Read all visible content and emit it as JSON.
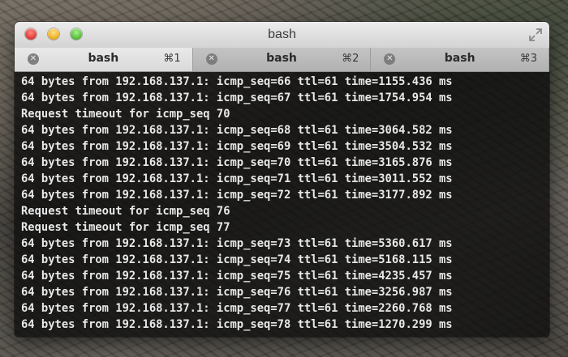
{
  "window": {
    "title": "bash"
  },
  "tabs": [
    {
      "label": "bash",
      "shortcut": "⌘1",
      "active": true
    },
    {
      "label": "bash",
      "shortcut": "⌘2",
      "active": false
    },
    {
      "label": "bash",
      "shortcut": "⌘3",
      "active": false
    }
  ],
  "terminal": {
    "lines": [
      "64 bytes from 192.168.137.1: icmp_seq=66 ttl=61 time=1155.436 ms",
      "64 bytes from 192.168.137.1: icmp_seq=67 ttl=61 time=1754.954 ms",
      "Request timeout for icmp_seq 70",
      "64 bytes from 192.168.137.1: icmp_seq=68 ttl=61 time=3064.582 ms",
      "64 bytes from 192.168.137.1: icmp_seq=69 ttl=61 time=3504.532 ms",
      "64 bytes from 192.168.137.1: icmp_seq=70 ttl=61 time=3165.876 ms",
      "64 bytes from 192.168.137.1: icmp_seq=71 ttl=61 time=3011.552 ms",
      "64 bytes from 192.168.137.1: icmp_seq=72 ttl=61 time=3177.892 ms",
      "Request timeout for icmp_seq 76",
      "Request timeout for icmp_seq 77",
      "64 bytes from 192.168.137.1: icmp_seq=73 ttl=61 time=5360.617 ms",
      "64 bytes from 192.168.137.1: icmp_seq=74 ttl=61 time=5168.115 ms",
      "64 bytes from 192.168.137.1: icmp_seq=75 ttl=61 time=4235.457 ms",
      "64 bytes from 192.168.137.1: icmp_seq=76 ttl=61 time=3256.987 ms",
      "64 bytes from 192.168.137.1: icmp_seq=77 ttl=61 time=2260.768 ms",
      "64 bytes from 192.168.137.1: icmp_seq=78 ttl=61 time=1270.299 ms"
    ]
  },
  "icons": {
    "tab_close": "close-icon",
    "close": "window-close-icon",
    "minimize": "window-minimize-icon",
    "zoom": "window-zoom-icon",
    "fullscreen": "fullscreen-icon"
  },
  "colors": {
    "close": "#e0443e",
    "minimize": "#f0b429",
    "zoom": "#5fc33f",
    "terminal_text": "#e8e8e8"
  }
}
